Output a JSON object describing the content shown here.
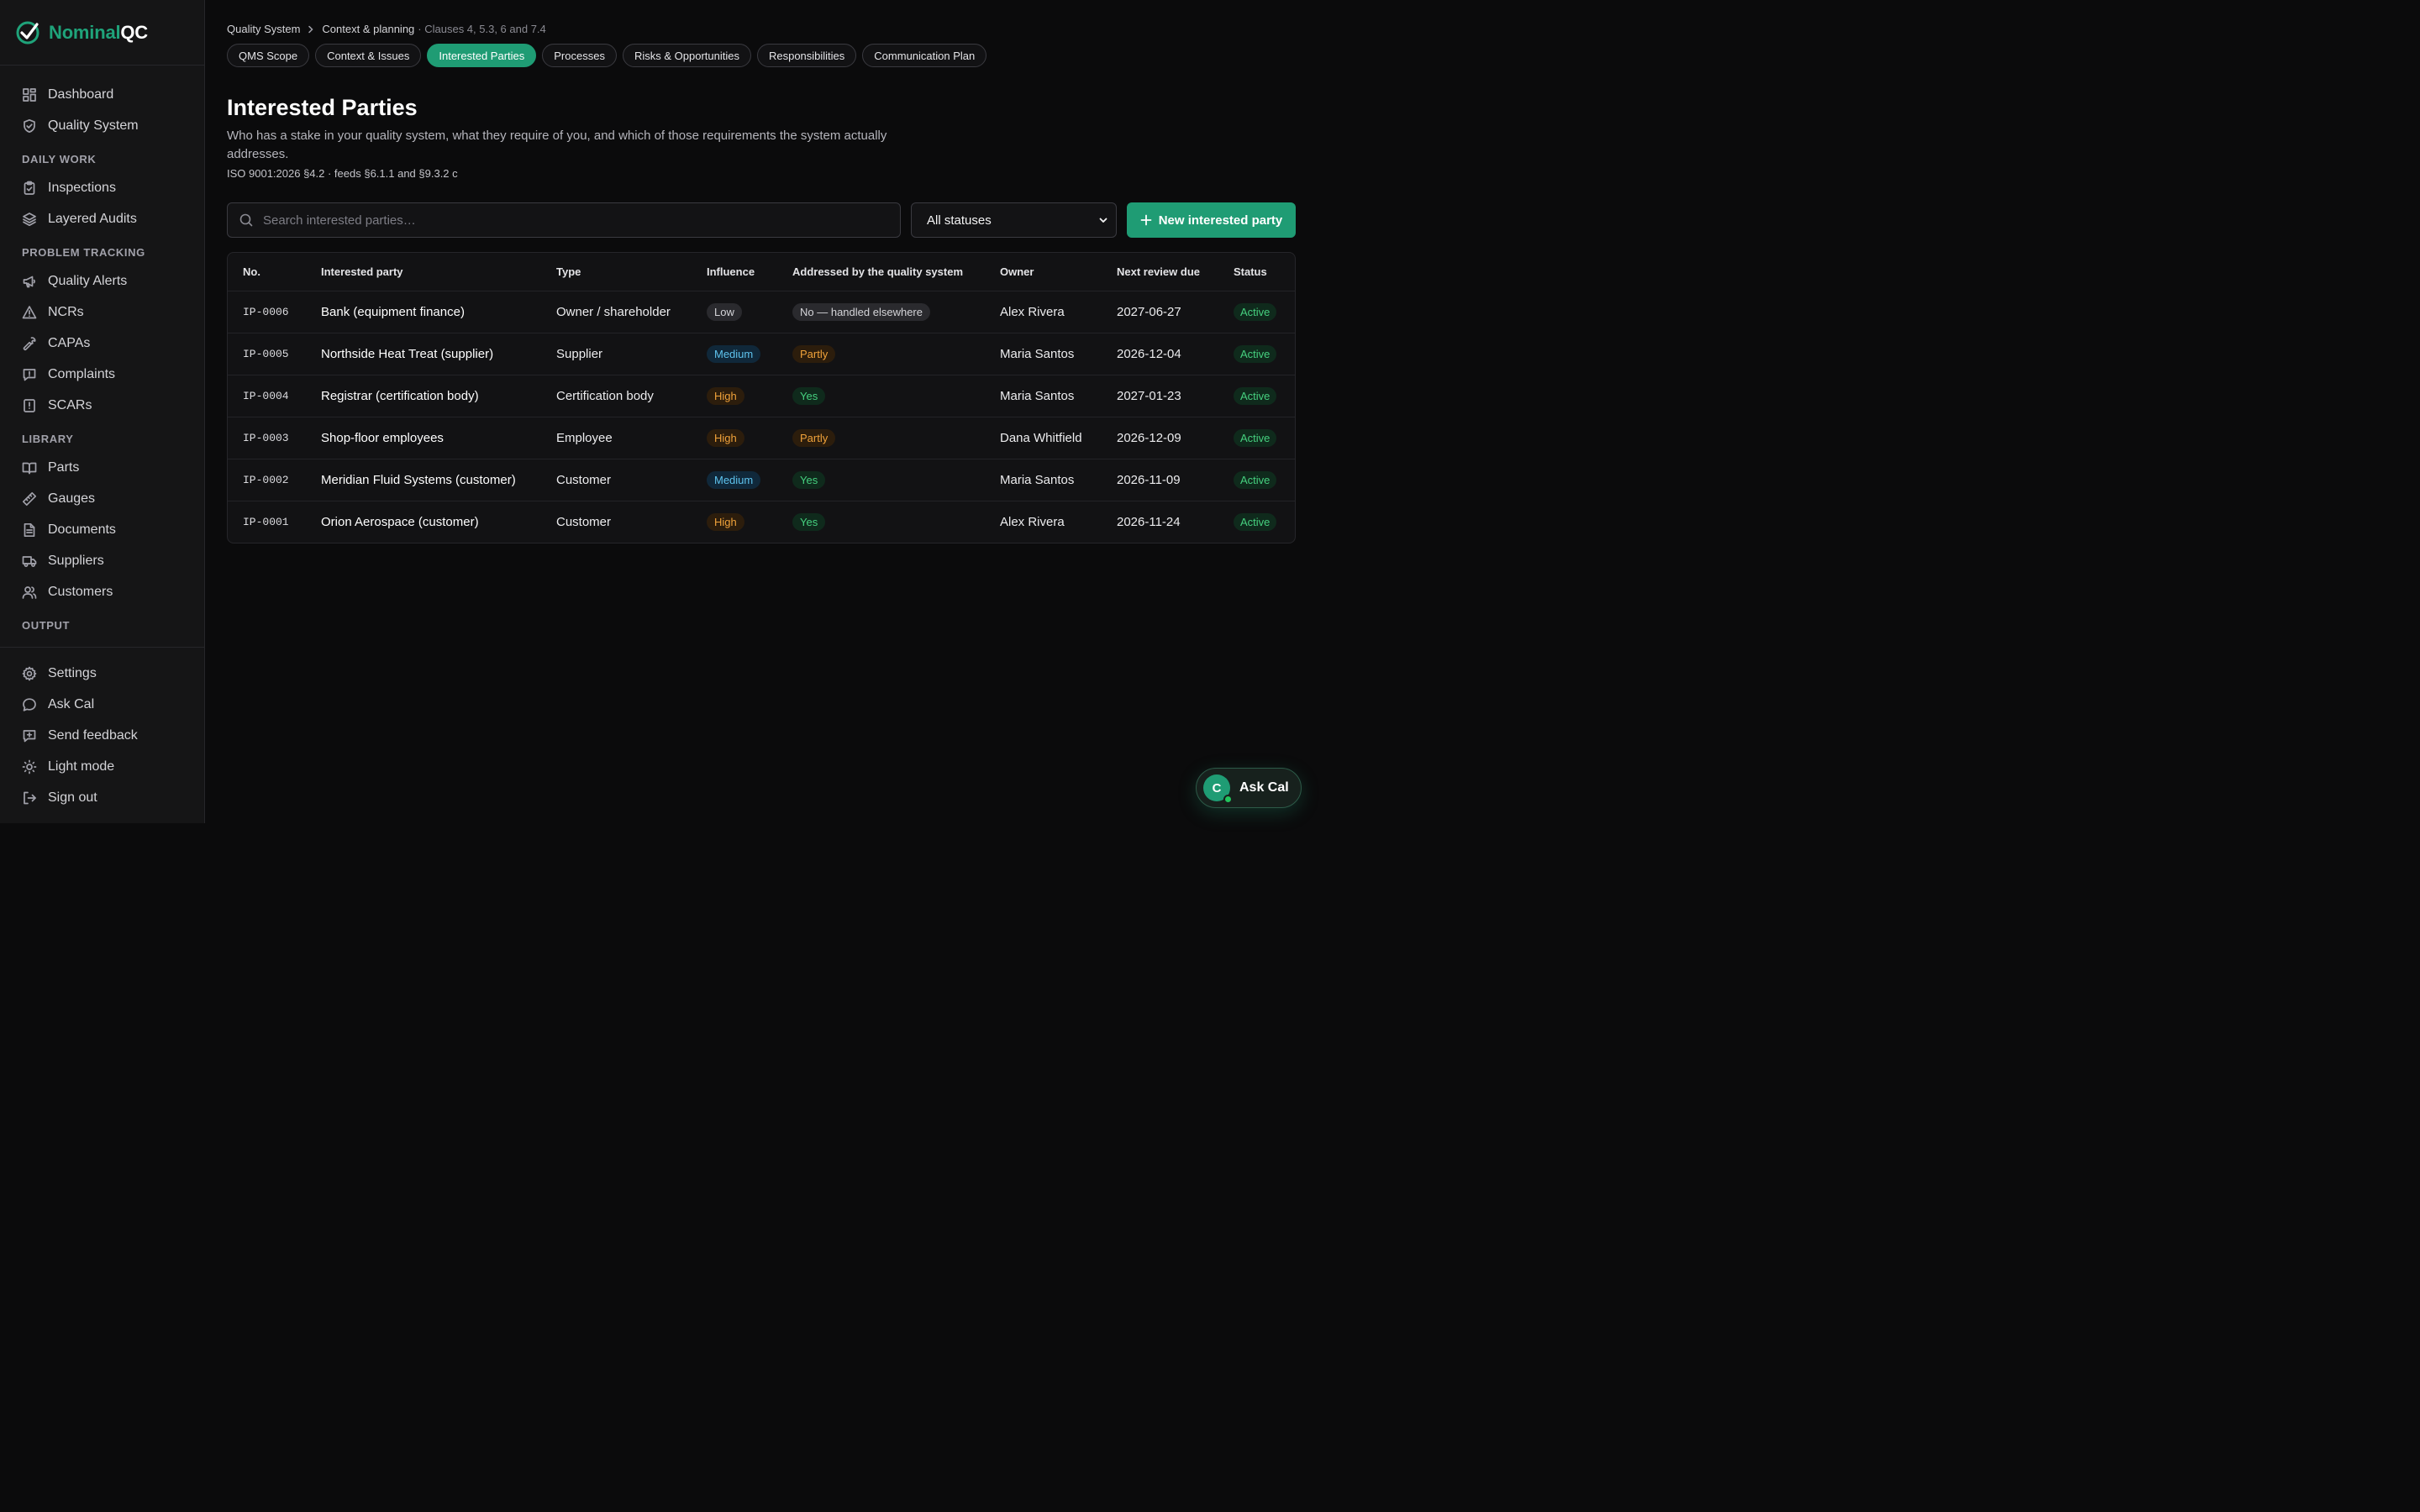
{
  "brand": {
    "name_part1": "Nominal",
    "name_part2": "QC"
  },
  "sidebar": {
    "top_items": [
      {
        "label": "Dashboard",
        "icon": "grid-icon"
      },
      {
        "label": "Quality System",
        "icon": "shield-check-icon"
      }
    ],
    "sections": [
      {
        "title": "DAILY WORK",
        "items": [
          {
            "label": "Inspections",
            "icon": "clipboard-check-icon"
          },
          {
            "label": "Layered Audits",
            "icon": "layers-icon"
          }
        ]
      },
      {
        "title": "PROBLEM TRACKING",
        "items": [
          {
            "label": "Quality Alerts",
            "icon": "megaphone-icon"
          },
          {
            "label": "NCRs",
            "icon": "warning-triangle-icon"
          },
          {
            "label": "CAPAs",
            "icon": "wrench-icon"
          },
          {
            "label": "Complaints",
            "icon": "message-alert-icon"
          },
          {
            "label": "SCARs",
            "icon": "file-alert-icon"
          }
        ]
      },
      {
        "title": "LIBRARY",
        "items": [
          {
            "label": "Parts",
            "icon": "book-icon"
          },
          {
            "label": "Gauges",
            "icon": "ruler-icon"
          },
          {
            "label": "Documents",
            "icon": "document-icon"
          },
          {
            "label": "Suppliers",
            "icon": "truck-icon"
          },
          {
            "label": "Customers",
            "icon": "users-icon"
          }
        ]
      },
      {
        "title": "OUTPUT",
        "items": []
      }
    ],
    "bottom_items": [
      {
        "label": "Settings",
        "icon": "gear-icon"
      },
      {
        "label": "Ask Cal",
        "icon": "chat-bubble-icon"
      },
      {
        "label": "Send feedback",
        "icon": "message-plus-icon"
      },
      {
        "label": "Light mode",
        "icon": "sun-icon"
      },
      {
        "label": "Sign out",
        "icon": "sign-out-icon"
      }
    ]
  },
  "breadcrumb": {
    "root": "Quality System",
    "current": "Context & planning",
    "suffix": "· Clauses 4, 5.3, 6 and 7.4"
  },
  "tabs": [
    {
      "label": "QMS Scope",
      "active": false
    },
    {
      "label": "Context & Issues",
      "active": false
    },
    {
      "label": "Interested Parties",
      "active": true
    },
    {
      "label": "Processes",
      "active": false
    },
    {
      "label": "Risks & Opportunities",
      "active": false
    },
    {
      "label": "Responsibilities",
      "active": false
    },
    {
      "label": "Communication Plan",
      "active": false
    }
  ],
  "page": {
    "title": "Interested Parties",
    "description": "Who has a stake in your quality system, what they require of you, and which of those requirements the system actually addresses.",
    "meta": "ISO 9001:2026 §4.2 · feeds §6.1.1 and §9.3.2 c"
  },
  "toolbar": {
    "search_placeholder": "Search interested parties…",
    "status_filter": "All statuses",
    "new_button": "New interested party"
  },
  "table": {
    "columns": [
      "No.",
      "Interested party",
      "Type",
      "Influence",
      "Addressed by the quality system",
      "Owner",
      "Next review due",
      "Status"
    ],
    "rows": [
      {
        "no": "IP-0006",
        "name": "Bank (equipment finance)",
        "type": "Owner / shareholder",
        "influence": "Low",
        "addressed": "No — handled elsewhere",
        "owner": "Alex Rivera",
        "due": "2027-06-27",
        "status": "Active"
      },
      {
        "no": "IP-0005",
        "name": "Northside Heat Treat (supplier)",
        "type": "Supplier",
        "influence": "Medium",
        "addressed": "Partly",
        "owner": "Maria Santos",
        "due": "2026-12-04",
        "status": "Active"
      },
      {
        "no": "IP-0004",
        "name": "Registrar (certification body)",
        "type": "Certification body",
        "influence": "High",
        "addressed": "Yes",
        "owner": "Maria Santos",
        "due": "2027-01-23",
        "status": "Active"
      },
      {
        "no": "IP-0003",
        "name": "Shop-floor employees",
        "type": "Employee",
        "influence": "High",
        "addressed": "Partly",
        "owner": "Dana Whitfield",
        "due": "2026-12-09",
        "status": "Active"
      },
      {
        "no": "IP-0002",
        "name": "Meridian Fluid Systems (customer)",
        "type": "Customer",
        "influence": "Medium",
        "addressed": "Yes",
        "owner": "Maria Santos",
        "due": "2026-11-09",
        "status": "Active"
      },
      {
        "no": "IP-0001",
        "name": "Orion Aerospace (customer)",
        "type": "Customer",
        "influence": "High",
        "addressed": "Yes",
        "owner": "Alex Rivera",
        "due": "2026-11-24",
        "status": "Active"
      }
    ]
  },
  "ask_cal": {
    "avatar_letter": "C",
    "label": "Ask Cal"
  },
  "colors": {
    "accent": "#1f9c74",
    "background": "#0b0b0c",
    "sidebar": "#151516",
    "warning": "#f0a23a",
    "success": "#46d07f",
    "info": "#5ec3ee"
  }
}
